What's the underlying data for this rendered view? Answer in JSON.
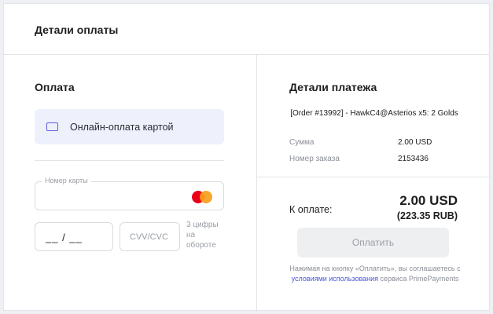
{
  "header": {
    "title": "Детали оплаты"
  },
  "payment": {
    "title": "Оплата",
    "method": {
      "icon": "credit-card-icon",
      "label": "Онлайн-оплата картой"
    },
    "card_number": {
      "label": "Номер карты",
      "value": "",
      "brand_icon": "mastercard-icon"
    },
    "expiry": {
      "value": "__ / __"
    },
    "cvv": {
      "placeholder": "CVV/CVC",
      "hint": "3 цифры на обороте"
    }
  },
  "details": {
    "title": "Детали платежа",
    "order_name": "[Order #13992] - HawkC4@Asterios x5: 2 Golds",
    "sum_label": "Сумма",
    "sum_value": "2.00 USD",
    "order_number_label": "Номер заказа",
    "order_number_value": "2153436"
  },
  "summary": {
    "to_pay_label": "К оплате:",
    "amount": "2.00 USD",
    "amount_rub": "(223.35 RUB)",
    "pay_button_label": "Оплатить",
    "terms_prefix": "Нажимая на кнопку «Оплатить», вы соглашаетесь с ",
    "terms_link": "условиями использования",
    "terms_suffix": " сервиса PrimePayments"
  },
  "colors": {
    "accent": "#5a5fd6",
    "method_bg": "#eef0fb",
    "link": "#4a58d6",
    "button_disabled_bg": "#eeeff1"
  }
}
